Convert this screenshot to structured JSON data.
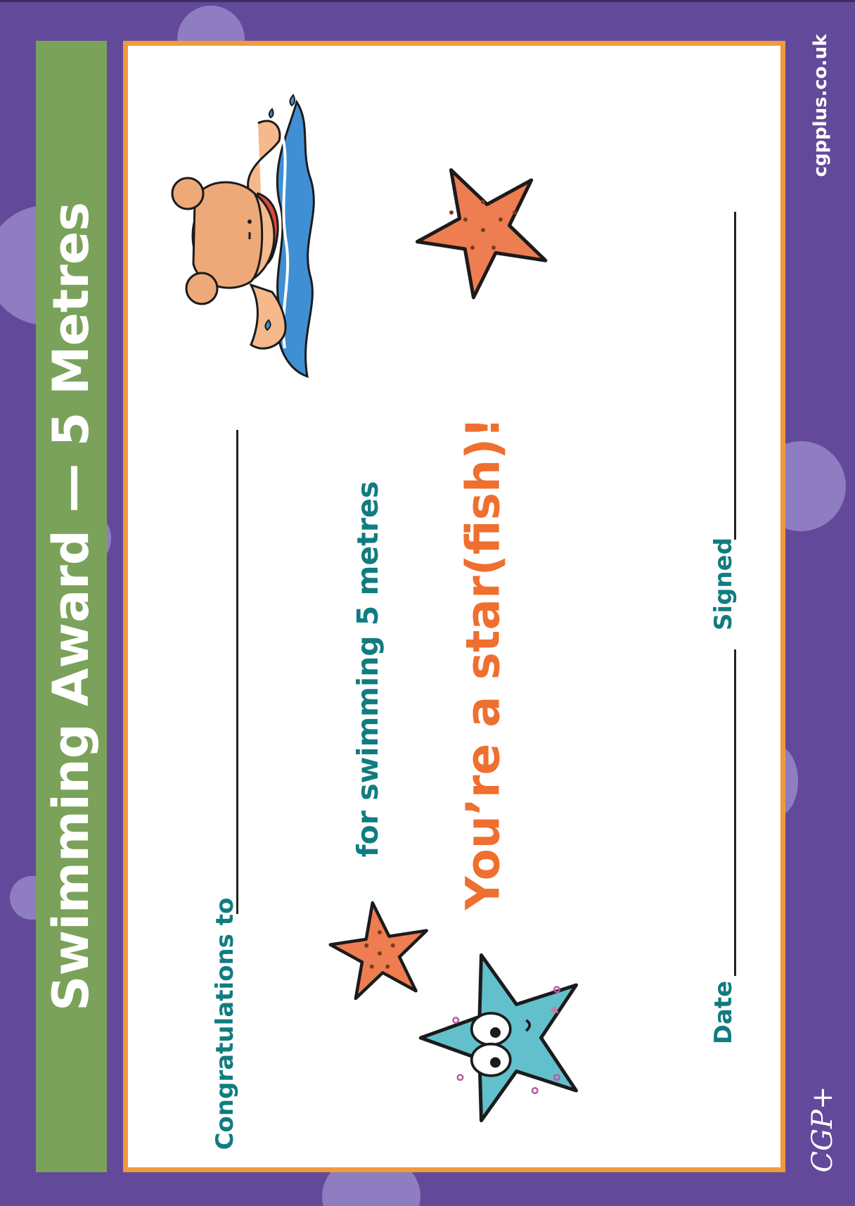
{
  "certificate": {
    "title": "Swimming Award — 5 Metres",
    "congratulations_label": "Congratulations to",
    "achievement_text": "for swimming 5 metres",
    "headline": "You’re a star(fish)!",
    "date_label": "Date",
    "signed_label": "Signed"
  },
  "footer": {
    "website": "cgpplus.co.uk",
    "logo_text": "CGP+"
  },
  "illustrations": {
    "swimmer": "swimming-girl-illustration",
    "starfish": [
      "orange-starfish",
      "orange-starfish",
      "blue-starfish-with-face"
    ]
  },
  "colors": {
    "background": "#63499a",
    "band": "#7aa25a",
    "border": "#ef9b3b",
    "text_teal": "#117c80",
    "headline_orange": "#ef6f2e",
    "starfish_orange": "#ee7d52",
    "starfish_blue": "#62c0cc"
  }
}
